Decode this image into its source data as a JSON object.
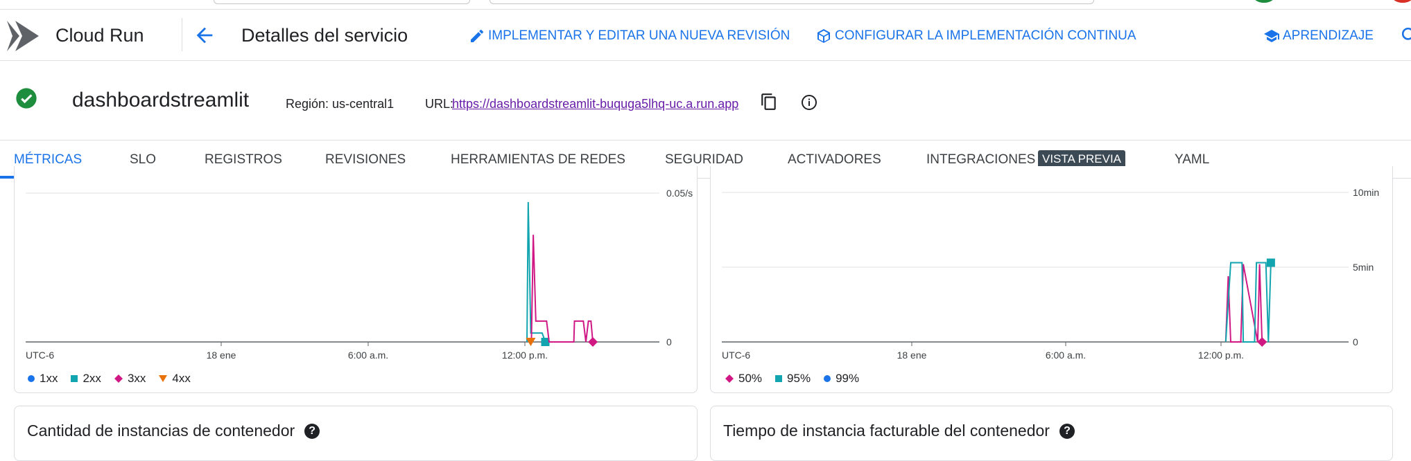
{
  "header": {
    "product_name": "Cloud Run",
    "page_title": "Detalles del servicio",
    "actions": [
      {
        "label": "IMPLEMENTAR Y EDITAR UNA NUEVA REVISIÓN",
        "icon": "pencil-icon"
      },
      {
        "label": "CONFIGURAR LA IMPLEMENTACIÓN CONTINUA",
        "icon": "cube-gear-icon"
      },
      {
        "label": "APRENDIZAJE",
        "icon": "school-icon"
      }
    ]
  },
  "service": {
    "name": "dashboardstreamlit",
    "status": "ok",
    "region_text": "Región: us-central1",
    "url_label": "URL:",
    "url": "https://dashboardstreamlit-buquga5lhq-uc.a.run.app"
  },
  "tabs": [
    {
      "label": "MÉTRICAS",
      "active": true
    },
    {
      "label": "SLO"
    },
    {
      "label": "REGISTROS"
    },
    {
      "label": "REVISIONES"
    },
    {
      "label": "HERRAMIENTAS DE REDES"
    },
    {
      "label": "SEGURIDAD"
    },
    {
      "label": "ACTIVADORES"
    },
    {
      "label": "INTEGRACIONES",
      "badge": "VISTA PREVIA"
    },
    {
      "label": "YAML"
    }
  ],
  "colors": {
    "accent": "#1a73e8",
    "s_blue": "#1a73e8",
    "s_teal": "#12a4af",
    "s_pink": "#d01884",
    "s_orange": "#e8710a"
  },
  "chart_data": [
    {
      "type": "line",
      "x_ticks": [
        "UTC-6",
        "18 ene",
        "6:00 a.m.",
        "12:00 p.m."
      ],
      "y_ticks": [
        "0",
        "0.05/s"
      ],
      "ylim": [
        0,
        0.05
      ],
      "series": [
        {
          "name": "1xx",
          "color": "#1a73e8",
          "marker": "circle",
          "points": []
        },
        {
          "name": "2xx",
          "color": "#12a4af",
          "marker": "square",
          "points": [
            [
              0.791,
              0
            ],
            [
              0.793,
              0.047
            ],
            [
              0.797,
              0.003
            ],
            [
              0.815,
              0.003
            ],
            [
              0.82,
              0
            ]
          ]
        },
        {
          "name": "3xx",
          "color": "#d01884",
          "marker": "diamond",
          "points": [
            [
              0.798,
              0
            ],
            [
              0.801,
              0.036
            ],
            [
              0.805,
              0.007
            ],
            [
              0.822,
              0.007
            ],
            [
              0.826,
              0
            ],
            [
              0.865,
              0
            ],
            [
              0.866,
              0.007
            ],
            [
              0.88,
              0.007
            ],
            [
              0.884,
              0
            ],
            [
              0.888,
              0.007
            ],
            [
              0.892,
              0.007
            ],
            [
              0.895,
              0
            ]
          ]
        },
        {
          "name": "4xx",
          "color": "#e8710a",
          "marker": "triangle",
          "points": [
            [
              0.797,
              0
            ]
          ]
        }
      ]
    },
    {
      "type": "line",
      "x_ticks": [
        "UTC-6",
        "18 ene",
        "6:00 a.m.",
        "12:00 p.m."
      ],
      "y_ticks": [
        "0",
        "5min",
        "10min"
      ],
      "ylim": [
        0,
        10
      ],
      "series": [
        {
          "name": "50%",
          "color": "#d01884",
          "marker": "diamond",
          "points": [
            [
              0.804,
              0
            ],
            [
              0.808,
              4.4
            ],
            [
              0.812,
              0
            ],
            [
              0.828,
              0
            ],
            [
              0.832,
              5.2
            ],
            [
              0.855,
              0
            ],
            [
              0.858,
              5.2
            ],
            [
              0.862,
              0
            ]
          ]
        },
        {
          "name": "95%",
          "color": "#12a4af",
          "marker": "square",
          "points": [
            [
              0.804,
              0
            ],
            [
              0.812,
              5.3
            ],
            [
              0.83,
              5.3
            ],
            [
              0.832,
              0
            ],
            [
              0.85,
              0
            ],
            [
              0.853,
              5.3
            ],
            [
              0.868,
              5.3
            ],
            [
              0.872,
              0
            ],
            [
              0.876,
              5.3
            ]
          ]
        },
        {
          "name": "99%",
          "color": "#1a73e8",
          "marker": "circle",
          "points": []
        }
      ]
    }
  ],
  "bottom_cards": [
    {
      "title": "Cantidad de instancias de contenedor"
    },
    {
      "title": "Tiempo de instancia facturable del contenedor"
    }
  ]
}
